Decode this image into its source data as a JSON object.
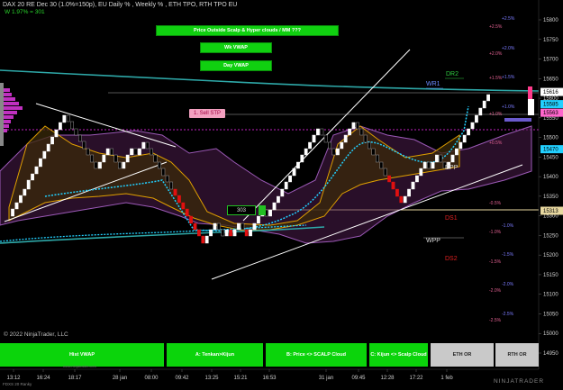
{
  "header": {
    "title": "DAX 20 RE Dec 30 (1.0%=150p), EU Daily % , Weekly % , ETH TPO, RTH TPO EU",
    "subtitle": "W 1.97% = 301"
  },
  "buttons_top": {
    "scalp": "Price Outside Scalp & Hyper clouds / MM ???",
    "wk_vwap": "Wk VWAP",
    "day_vwap": "Day VWAP"
  },
  "buttons_bottom": {
    "hist_vwap": "Hist VWAP",
    "tenkan": "A: Tenkan>Kijun",
    "scalp_cloud": "B: Price <> SCALP Cloud",
    "kijun": "C: Kijun <> Scalp Cloud",
    "eth_or": "ETH OR",
    "rth_or": "RTH OR"
  },
  "labels": {
    "dr2": "DR2",
    "wr1": "WR1",
    "dpp": "DPP",
    "ds1": "DS1",
    "wpp": "WPP",
    "ds2": "DS2",
    "sell_stp": "1. Sell STP",
    "small_box": "303",
    "copyright": "© 2022 NinjaTrader, LLC",
    "url": "www.ninjatrader.com",
    "footer": "FDXS 20 Ranky",
    "brand": "NINJATRADER"
  },
  "price_axis": {
    "ticks": [
      "15800",
      "15750",
      "15700",
      "15650",
      "15600",
      "15550",
      "15500",
      "15450",
      "15400",
      "15350",
      "15300",
      "15250",
      "15200",
      "15150",
      "15100",
      "15050",
      "15000",
      "14950"
    ],
    "tags": [
      {
        "text": "15616",
        "color": "#ffffff"
      },
      {
        "text": "15585",
        "color": "#22d0ff"
      },
      {
        "text": "15563",
        "color": "#ff66cc"
      },
      {
        "text": "15470",
        "color": "#22d0ff"
      },
      {
        "text": "15313",
        "color": "#e8d8a0"
      }
    ]
  },
  "time_axis": [
    "13:12",
    "16:24",
    "18:17",
    "28 jan",
    "08:00",
    "09:42",
    "13:25",
    "15:21",
    "16:53",
    "31 jan",
    "09:45",
    "12:28",
    "17:22",
    "1 feb"
  ],
  "pct_labels": {
    "daily": [
      "+2.5%",
      "+2.0%",
      "+1.5%",
      "+1.0%",
      "+0.5%",
      "-0.5%",
      "-1.0%",
      "-1.5%",
      "-2.0%",
      "-2.5%"
    ],
    "weekly": [
      "+2.5%",
      "+2.0%",
      "+1.5%",
      "+1.0%",
      "-1.0%",
      "-1.5%",
      "-2.0%",
      "-2.5%"
    ]
  },
  "colors": {
    "up": "#ffffff",
    "down": "#000000",
    "red": "#e01010",
    "ichimoku": "#9b59b6",
    "kijun": "#e0a000",
    "vwap": "#22d0ff",
    "teal": "#2ea8a8",
    "magenta": "#c030c0"
  }
}
